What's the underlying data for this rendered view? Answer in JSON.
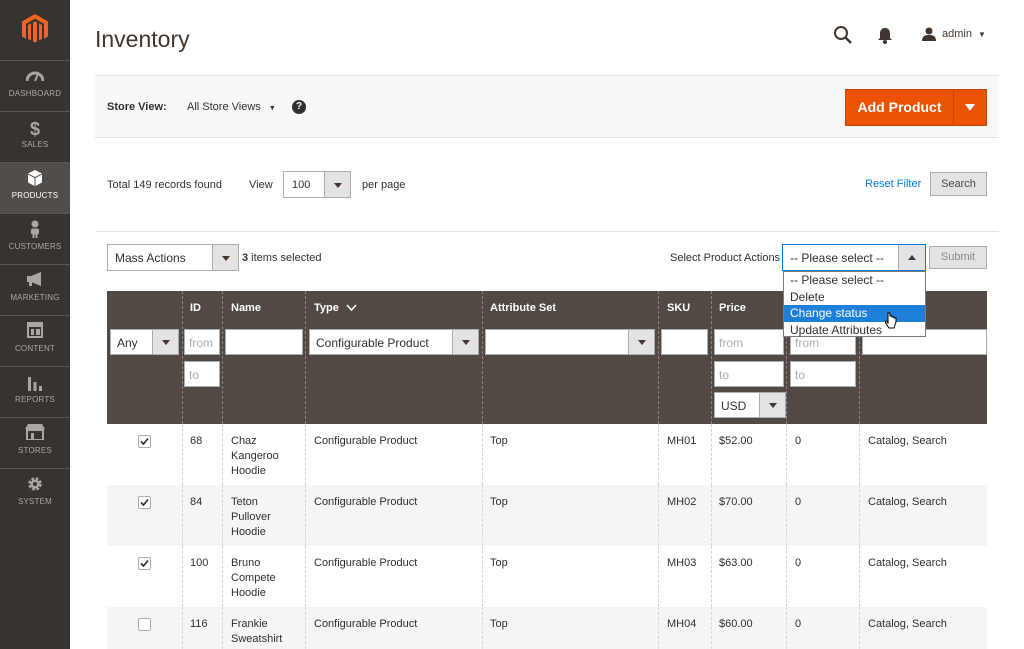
{
  "sidebar": {
    "items": [
      {
        "label": "DASHBOARD",
        "icon": "dashboard-icon"
      },
      {
        "label": "SALES",
        "icon": "dollar-icon"
      },
      {
        "label": "PRODUCTS",
        "icon": "cube-icon",
        "active": true
      },
      {
        "label": "CUSTOMERS",
        "icon": "person-icon"
      },
      {
        "label": "MARKETING",
        "icon": "megaphone-icon"
      },
      {
        "label": "CONTENT",
        "icon": "layout-icon"
      },
      {
        "label": "REPORTS",
        "icon": "bar-chart-icon"
      },
      {
        "label": "STORES",
        "icon": "store-icon"
      },
      {
        "label": "SYSTEM",
        "icon": "gear-icon"
      }
    ]
  },
  "header": {
    "title": "Inventory",
    "user": "admin"
  },
  "store_bar": {
    "label": "Store View:",
    "value": "All Store Views",
    "help": "?",
    "add_product": "Add Product"
  },
  "toolbar": {
    "records": "Total 149 records found",
    "view_label": "View",
    "view_value": "100",
    "per_page": "per page",
    "reset_filter": "Reset Filter",
    "search": "Search"
  },
  "actions": {
    "mass_actions": "Mass Actions",
    "selected_count": "3",
    "selected_text": " items selected",
    "select_label": "Select Product Actions",
    "select_value": "-- Please select --",
    "submit": "Submit",
    "options": [
      "-- Please select --",
      "Delete",
      "Change status",
      "Update Attributes"
    ],
    "highlighted": "Change status"
  },
  "grid": {
    "headers": {
      "id": "ID",
      "name": "Name",
      "type": "Type",
      "attribute_set": "Attribute Set",
      "sku": "SKU",
      "price": "Price"
    },
    "filters": {
      "any": "Any",
      "from": "from",
      "to": "to",
      "type": "Configurable Product",
      "currency": "USD"
    },
    "rows": [
      {
        "checked": true,
        "id": "68",
        "name": "Chaz Kangeroo Hoodie",
        "type": "Configurable Product",
        "attribute_set": "Top",
        "sku": "MH01",
        "price": "$52.00",
        "qty": "0",
        "visibility": "Catalog, Search"
      },
      {
        "checked": true,
        "id": "84",
        "name": "Teton Pullover Hoodie",
        "type": "Configurable Product",
        "attribute_set": "Top",
        "sku": "MH02",
        "price": "$70.00",
        "qty": "0",
        "visibility": "Catalog, Search"
      },
      {
        "checked": true,
        "id": "100",
        "name": "Bruno Compete Hoodie",
        "type": "Configurable Product",
        "attribute_set": "Top",
        "sku": "MH03",
        "price": "$63.00",
        "qty": "0",
        "visibility": "Catalog, Search"
      },
      {
        "checked": false,
        "id": "116",
        "name": "Frankie Sweatshirt",
        "type": "Configurable Product",
        "attribute_set": "Top",
        "sku": "MH04",
        "price": "$60.00",
        "qty": "0",
        "visibility": "Catalog, Search"
      }
    ]
  },
  "colors": {
    "sidebar": "#373330",
    "accent": "#eb5202",
    "grid_header": "#514943",
    "link": "#007bdb"
  }
}
